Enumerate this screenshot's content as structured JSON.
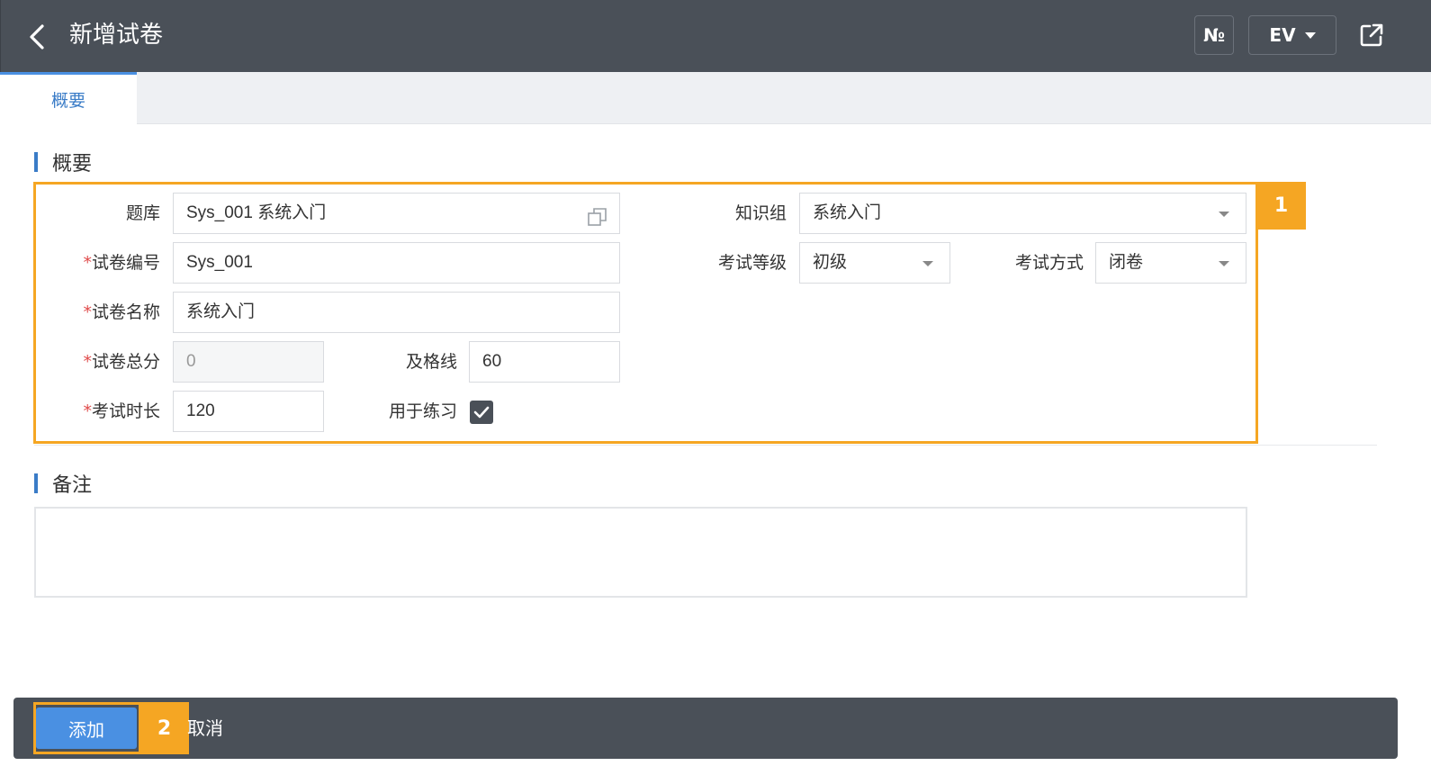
{
  "header": {
    "title": "新增试卷",
    "num_button": "№",
    "lang_button": "EV"
  },
  "tabs": [
    {
      "label": "概要",
      "active": true
    }
  ],
  "summary_section": {
    "title": "概要",
    "fields": {
      "question_bank": {
        "label": "题库",
        "value": "Sys_001 系统入门"
      },
      "knowledge_group": {
        "label": "知识组",
        "value": "系统入门"
      },
      "paper_code": {
        "label": "试卷编号",
        "value": "Sys_001",
        "required": true
      },
      "exam_level": {
        "label": "考试等级",
        "value": "初级"
      },
      "exam_mode": {
        "label": "考试方式",
        "value": "闭卷"
      },
      "paper_name": {
        "label": "试卷名称",
        "value": "系统入门",
        "required": true
      },
      "total_score": {
        "label": "试卷总分",
        "value": "0",
        "required": true
      },
      "pass_line": {
        "label": "及格线",
        "value": "60"
      },
      "duration": {
        "label": "考试时长",
        "value": "120",
        "required": true
      },
      "for_practice": {
        "label": "用于练习",
        "checked": true
      }
    },
    "required_mark": "*"
  },
  "notes_section": {
    "title": "备注",
    "value": ""
  },
  "footer": {
    "add_label": "添加",
    "cancel_label": "取消"
  },
  "callouts": {
    "one": "1",
    "two": "2"
  },
  "colors": {
    "header_bg": "#4a5058",
    "accent_blue": "#4a90e2",
    "callout_orange": "#f5a623",
    "required_red": "#e04b4b"
  }
}
